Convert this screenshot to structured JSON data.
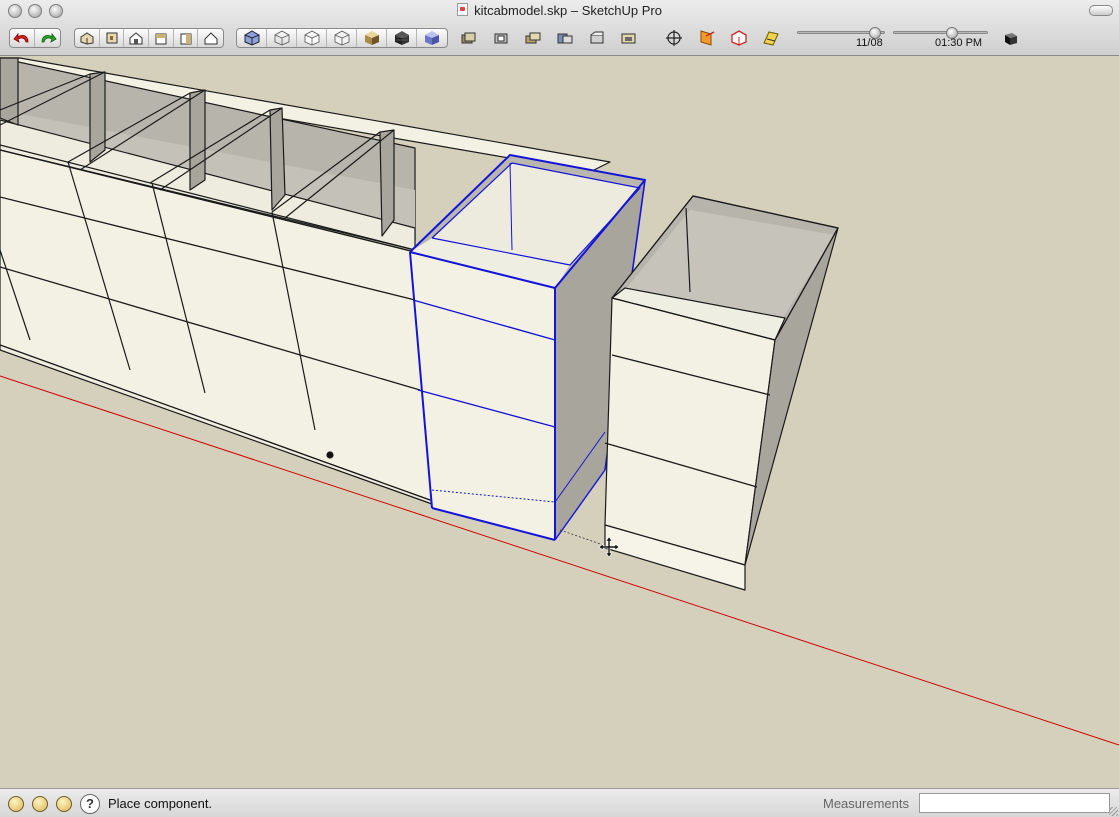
{
  "window": {
    "title": "kitcabmodel.skp – SketchUp Pro"
  },
  "toolbar": {
    "undo_redo": [
      "undo-icon",
      "redo-icon"
    ],
    "views": [
      "iso-view-icon",
      "top-view-icon",
      "front-view-icon",
      "right-view-icon",
      "back-view-icon",
      "left-view-icon"
    ],
    "styles": [
      "xray-icon",
      "wireframe-icon",
      "hidden-line-icon",
      "shaded-icon",
      "shaded-textures-icon",
      "monochrome-icon",
      "style-blue-icon"
    ],
    "layers": [
      "layer-1-icon",
      "layer-2-icon",
      "layer-3-icon",
      "layer-4-icon",
      "layer-5-icon",
      "layer-6-icon"
    ],
    "tools": [
      "axes-icon",
      "section-plane-icon",
      "display-section-icon",
      "section-cuts-icon"
    ],
    "shadows": {
      "date_label": "11/08",
      "time_label": "01:30 PM",
      "date_value": 0.88,
      "time_value": 0.61
    },
    "shadow_toggle": "shadow-toggle-icon"
  },
  "statusbar": {
    "icons": [
      "geo-location-icon",
      "credits-icon",
      "google-icon"
    ],
    "help": "?",
    "status": "Place component.",
    "measurements_label": "Measurements",
    "measurements_value": ""
  },
  "colors": {
    "background": "#d4d0bc",
    "cabinet_face": "#f3f1e3",
    "cabinet_side": "#a8a69c",
    "cabinet_inside": "#b9b7ad",
    "selection": "#1414d8",
    "axis_red": "#d20000"
  }
}
